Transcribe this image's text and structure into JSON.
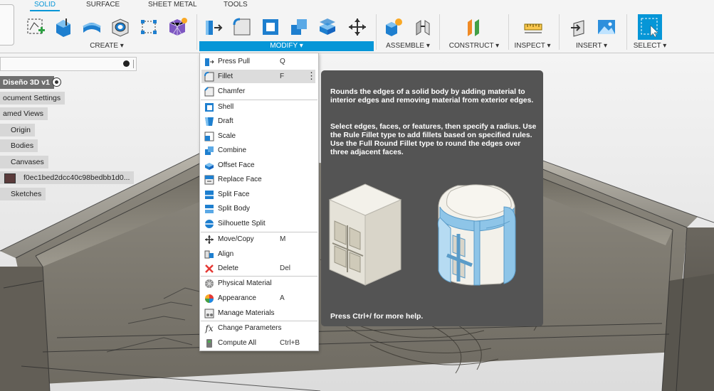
{
  "tabs": [
    "SOLID",
    "SURFACE",
    "SHEET METAL",
    "TOOLS"
  ],
  "toolbar_groups": {
    "create": "CREATE ▾",
    "modify": "MODIFY ▾",
    "assemble": "ASSEMBLE ▾",
    "construct": "CONSTRUCT ▾",
    "inspect": "INSPECT ▾",
    "insert": "INSERT ▾",
    "select": "SELECT ▾"
  },
  "browser": {
    "root": "Diseño 3D v1",
    "items": [
      "ocument Settings",
      "amed Views",
      "Origin",
      "Bodies",
      "Canvases",
      "f0ec1bed2dcc40c98bedbb1d0...",
      "Sketches"
    ]
  },
  "modify_menu": {
    "items": [
      {
        "label": "Press Pull",
        "shortcut": "Q",
        "icon": "press-pull-icon"
      },
      {
        "label": "Fillet",
        "shortcut": "F",
        "icon": "fillet-icon",
        "highlighted": true
      },
      {
        "label": "Chamfer",
        "shortcut": "",
        "icon": "chamfer-icon"
      },
      {
        "label": "Shell",
        "shortcut": "",
        "icon": "shell-icon"
      },
      {
        "label": "Draft",
        "shortcut": "",
        "icon": "draft-icon"
      },
      {
        "label": "Scale",
        "shortcut": "",
        "icon": "scale-icon"
      },
      {
        "label": "Combine",
        "shortcut": "",
        "icon": "combine-icon"
      },
      {
        "label": "Offset Face",
        "shortcut": "",
        "icon": "offset-face-icon"
      },
      {
        "label": "Replace Face",
        "shortcut": "",
        "icon": "replace-face-icon"
      },
      {
        "label": "Split Face",
        "shortcut": "",
        "icon": "split-face-icon"
      },
      {
        "label": "Split Body",
        "shortcut": "",
        "icon": "split-body-icon"
      },
      {
        "label": "Silhouette Split",
        "shortcut": "",
        "icon": "silhouette-split-icon"
      },
      {
        "label": "Move/Copy",
        "shortcut": "M",
        "icon": "move-icon"
      },
      {
        "label": "Align",
        "shortcut": "",
        "icon": "align-icon"
      },
      {
        "label": "Delete",
        "shortcut": "Del",
        "icon": "delete-icon"
      },
      {
        "label": "Physical Material",
        "shortcut": "",
        "icon": "physical-material-icon"
      },
      {
        "label": "Appearance",
        "shortcut": "A",
        "icon": "appearance-icon"
      },
      {
        "label": "Manage Materials",
        "shortcut": "",
        "icon": "manage-materials-icon"
      },
      {
        "label": "Change Parameters",
        "shortcut": "",
        "icon": "fx-icon"
      },
      {
        "label": "Compute All",
        "shortcut": "Ctrl+B",
        "icon": "compute-all-icon"
      }
    ]
  },
  "tooltip": {
    "para1": "Rounds the edges of a solid body by adding material to interior edges and removing material from exterior edges.",
    "para2": "Select edges, faces, or features, then specify a radius. Use the Rule Fillet type to add fillets based on specified rules. Use the Full Round Fillet type to round the edges over three adjacent faces.",
    "help": "Press Ctrl+/ for more help."
  },
  "colors": {
    "accent": "#0696d7",
    "tooltip_bg": "#545454",
    "fillet_blue": "#8ec5e8",
    "delete_red": "#e53935"
  }
}
